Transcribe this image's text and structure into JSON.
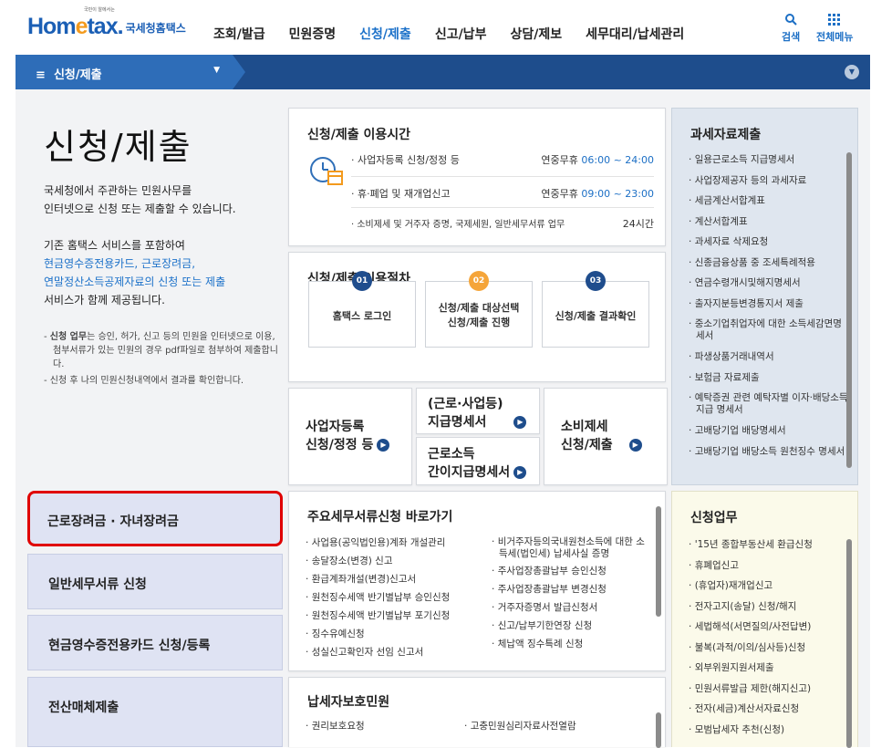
{
  "header": {
    "logo_small": "국민이 알에서는",
    "logo_ho": "Hom",
    "logo_e": "e",
    "logo_tax": "tax.",
    "logo_kr": "국세청홈택스",
    "nav": [
      "조회/발급",
      "민원증명",
      "신청/제출",
      "신고/납부",
      "상담/제보",
      "세무대리/납세관리"
    ],
    "search_label": "검색",
    "menu_label": "전체메뉴"
  },
  "breadcrumb": {
    "label": "신청/제출"
  },
  "intro": {
    "title": "신청/제출",
    "p1": [
      "국세청에서 주관하는 민원사무를",
      "인터넷으로 신청 또는 제출할 수 있습니다."
    ],
    "p2_line1": "기존 홈택스 서비스를 포함하여",
    "p2_link1": "현금영수증전용카드, 근로장려금,",
    "p2_link2": "연말정산소득공제자료의 신청 또는 제출",
    "p2_line2": "서비스가 함께 제공됩니다.",
    "notes": [
      {
        "bold": "신청 업무",
        "text": "는 승인, 허가, 신고 등의 민원을 인터넷으로 이용, 첨부서류가 있는 민원의 경우 pdf파일로 첨부하여 제출합니다."
      },
      {
        "bold": "",
        "text": "신청 후 나의 민원신청내역에서 결과를 확인합니다."
      }
    ]
  },
  "left_buttons": [
    "근로장려금 · 자녀장려금",
    "일반세무서류 신청",
    "현금영수증전용카드 신청/등록",
    "전산매체제출"
  ],
  "hours": {
    "title": "신청/제출 이용시간",
    "rows": [
      {
        "label": "사업자등록 신청/정정 등",
        "days": "연중무휴",
        "time": "06:00 ~ 24:00"
      },
      {
        "label": "휴·폐업 및 재개업신고",
        "days": "연중무휴",
        "time": "09:00 ~ 23:00"
      },
      {
        "label": "소비제세 및 거주자 증명, 국제세원, 일반세무서류 업무",
        "days": "",
        "time": "24시간"
      }
    ]
  },
  "procedure": {
    "title": "신청/제출 이용절차",
    "steps": [
      {
        "num": "01",
        "label": "홈택스 로그인"
      },
      {
        "num": "02",
        "label": "신청/제출 대상선택 신청/제출 진행"
      },
      {
        "num": "03",
        "label": "신청/제출 결과확인"
      }
    ]
  },
  "quick": {
    "biz": [
      "사업자등록",
      "신청/정정 등"
    ],
    "pay1": [
      "(근로·사업등)",
      "지급명세서"
    ],
    "pay2": [
      "근로소득",
      "간이지급명세서"
    ],
    "consume": [
      "소비제세",
      "신청/제출"
    ]
  },
  "shortcuts": {
    "title": "주요세무서류신청 바로가기",
    "col1": [
      "사업용(공익법인용)계좌 개설관리",
      "송달장소(변경) 신고",
      "환급계좌개설(변경)신고서",
      "원천징수세액 반기별납부 승인신청",
      "원천징수세액 반기별납부 포기신청",
      "징수유예신청",
      "성실신고확인자 선임 신고서"
    ],
    "col2": [
      "비거주자등의국내원천소득에 대한 소득세(법인세) 납세사실 증명",
      "주사업장총괄납부 승인신청",
      "주사업장총괄납부 변경신청",
      "거주자증명서 발급신청서",
      "신고/납부기한연장 신청",
      "체납액 징수특례 신청"
    ]
  },
  "protection": {
    "title": "납세자보호민원",
    "col1": [
      "권리보호요청"
    ],
    "col2": [
      "고충민원심리자료사전열람"
    ]
  },
  "taxdata": {
    "title": "과세자료제출",
    "items": [
      "일용근로소득 지급명세서",
      "사업장제공자 등의 과세자료",
      "세금계산서합계표",
      "계산서합계표",
      "과세자료 삭제요청",
      "신종금융상품 중 조세특례적용",
      "연금수령개시및해지명세서",
      "출자지분등변경통지서 제출",
      "중소기업취업자에 대한 소득세감면명세서",
      "파생상품거래내역서",
      "보험금 자료제출",
      "예탁증권 관련 예탁자별 이자·배당소득 지급 명세서",
      "고배당기업 배당명세서",
      "고배당기업 배당소득 원천징수 명세서"
    ]
  },
  "apply": {
    "title": "신청업무",
    "items": [
      "'15년 종합부동산세 환급신청",
      "휴폐업신고",
      "(휴업자)재개업신고",
      "전자고지(송달) 신청/해지",
      "세법해석(서면질의/사전답변)",
      "불복(과적/이의/심사등)신청",
      "외부위원지원서제출",
      "민원서류발급 제한(해지신고)",
      "전자(세금)계산서자료신청",
      "모범납세자 추천(신청)"
    ]
  }
}
